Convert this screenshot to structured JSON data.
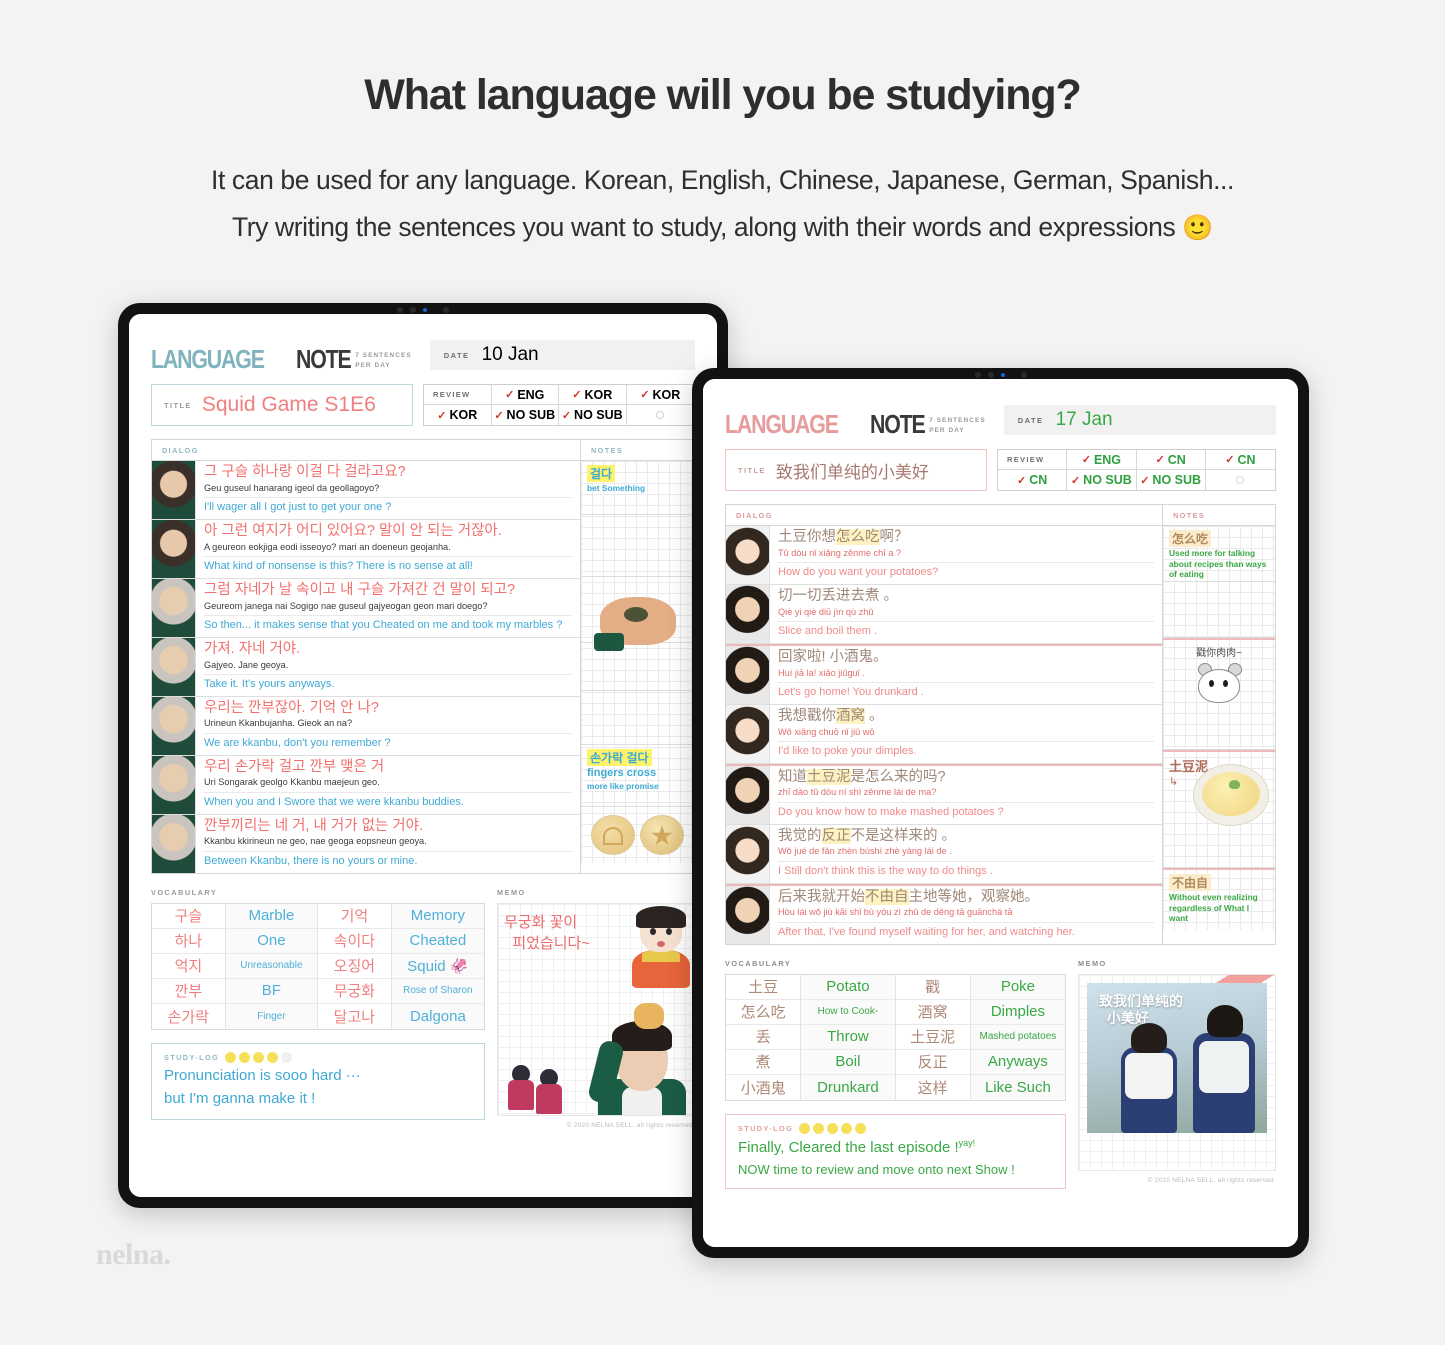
{
  "hero": {
    "title": "What language will you be studying?",
    "line1": "It can be used for any language. Korean, English, Chinese, Japanese, German, Spanish...",
    "line2": "Try writing the sentences you want to study, along with their words and expressions",
    "emoji": "🙂"
  },
  "watermark": "nelna.",
  "tablet_one": {
    "brand": {
      "word1": "LANGUAGE",
      "word2": "NOTE",
      "tag_line1": "7 SENTENCES",
      "tag_line2": "PER DAY"
    },
    "date": {
      "label": "DATE",
      "value": "10 Jan"
    },
    "title": {
      "label": "TITLE",
      "value": "Squid Game S1E6"
    },
    "review": {
      "header": "REVIEW",
      "cells": [
        "ENG",
        "KOR",
        "KOR",
        "KOR",
        "NO SUB",
        "NO SUB",
        ""
      ]
    },
    "dialog_header": "DIALOG",
    "notes_header": "NOTES",
    "dialog": [
      {
        "orig": "그 구슬 하나랑 이걸 다 걸라고요?",
        "roman": "Geu guseul hanarang  igeol da  geollagoyo?",
        "trans": "I'll wager all I got just to get your one ?"
      },
      {
        "orig": "아 그런 여지가 어디 있어요? 말이 안 되는 거잖아.",
        "roman": "A  geureon eokjiga  eodi  isseoyo? mari  an  doeneun geojanha.",
        "trans": "What kind of nonsense is this? There is no sense at all!"
      },
      {
        "orig": "그럼 자네가 날 속이고 내 구슬 가져간 건  말이 되고?",
        "roman": "Geureom janega nai  Sogigo nae guseul gajyeogan geon mari doego?",
        "trans": "So then... it makes sense that you Cheated on me and took my marbles ?"
      },
      {
        "orig": "가져. 자네 거야.",
        "roman": "Gajyeo.  Jane geoya.",
        "trans": "Take it. It's yours anyways."
      },
      {
        "orig": "우리는 깐부잖아. 기억 안 나?",
        "roman": "Urineun  Kkanbujanha. Gieok an na?",
        "trans": "We are  kkanbu, don't you remember ?"
      },
      {
        "orig": "우리 손가락 걸고 깐부 맺은 거",
        "roman": "Uri  Songarak geolgo Kkanbu maejeun geo.",
        "trans": "When you and I Swore that we were kkanbu buddies."
      },
      {
        "orig": "깐부끼리는 네 거, 내 거가 없는 거야.",
        "roman": "Kkanbu kkirineun  ne geo, nae geoga eopsneun geoya.",
        "trans": "Between Kkanbu, there is no yours or mine."
      }
    ],
    "notes": [
      {
        "keyword": "걸다",
        "text": "bet Something"
      },
      {
        "keyword": "",
        "text": ""
      },
      {
        "keyword": "",
        "text": "",
        "image": "hand-with-marbles"
      },
      {
        "keyword": "",
        "text": ""
      },
      {
        "keyword": "",
        "text": ""
      },
      {
        "keyword": "손가락 걸다",
        "text": "fingers cross",
        "subtext": "more like promise"
      },
      {
        "keyword": "",
        "text": "",
        "image": "dalgona-candies"
      }
    ],
    "vocabulary_label": "VOCABULARY",
    "vocabulary": [
      {
        "term": "구슬",
        "meaning": "Marble"
      },
      {
        "term": "기억",
        "meaning": "Memory"
      },
      {
        "term": "하나",
        "meaning": "One"
      },
      {
        "term": "속이다",
        "meaning": "Cheated"
      },
      {
        "term": "억지",
        "meaning": "Unreasonable",
        "small": true
      },
      {
        "term": "오징어",
        "meaning": "Squid 🦑"
      },
      {
        "term": "깐부",
        "meaning": "BF"
      },
      {
        "term": "무궁화",
        "meaning": "Rose of Sharon",
        "small": true
      },
      {
        "term": "손가락",
        "meaning": "Finger",
        "small": true
      },
      {
        "term": "달고나",
        "meaning": "Dalgona"
      }
    ],
    "study_log": {
      "label": "STUDY-LOG",
      "smileys_filled": 4,
      "smileys_total": 5,
      "line1": "Pronunciation is sooo hard ···",
      "line2": "but I'm ganna make it !"
    },
    "memo_label": "MEMO",
    "memo_text": "무궁화 꽃이\n피었습니다~",
    "copyright": "© 2020 NELNA SELL. all rights reserved."
  },
  "tablet_two": {
    "brand": {
      "word1": "LANGUAGE",
      "word2": "NOTE",
      "tag_line1": "7 SENTENCES",
      "tag_line2": "PER DAY"
    },
    "date": {
      "label": "DATE",
      "value": "17 Jan"
    },
    "title": {
      "label": "TITLE",
      "value": "致我们单纯的小美好"
    },
    "review": {
      "header": "REVIEW",
      "cells": [
        "ENG",
        "CN",
        "CN",
        "CN",
        "NO SUB",
        "NO SUB",
        ""
      ]
    },
    "dialog_header": "DIALOG",
    "notes_header": "NOTES",
    "dialog": [
      {
        "orig_pre": "土豆你想",
        "orig_hl": "怎么吃",
        "orig_post": "啊？",
        "roman": "Tǔ dòu nǐ xiǎng zěnme chī a ?",
        "trans": "How do you  want your potatoes?"
      },
      {
        "orig_pre": "切一切丢进去煮 。",
        "orig_hl": "",
        "orig_post": "",
        "roman": "Qiè yi  qiè diū jìn qù  zhǔ",
        "trans": "Slice and boil them ."
      },
      {
        "orig_pre": "回家啦!  小酒鬼。",
        "orig_hl": "",
        "orig_post": "",
        "roman": "Huí jiā  la!   xiǎo jiǔguǐ .",
        "trans": "Let's go home! You drunkard ."
      },
      {
        "orig_pre": "我想戳你",
        "orig_hl": "酒窝",
        "orig_post": " 。",
        "roman": "Wǒ xiǎng chuō nǐ  jiǔ wō",
        "trans": "I'd like to poke your dimples."
      },
      {
        "orig_pre": "知道",
        "orig_hl": "土豆泥",
        "orig_post": "是怎么来的吗?",
        "roman": "zhī dào tǔ dòu ní shì zěnme lái de ma?",
        "trans": "Do you know how to make mashed potatoes ?"
      },
      {
        "orig_pre": "我觉的",
        "orig_hl": "反正",
        "orig_post": "不是这样来的 。",
        "roman": "Wǒ jué de fǎn zhèn búshì zhè yàng lái de .",
        "trans": "I Still don't think this is the way to do things ."
      },
      {
        "orig_pre": "后来我就开始",
        "orig_hl": "不由自",
        "orig_post": "主地等她，观察她。",
        "roman": "Hòu lái wǒ jiù kāi shǐ bù yóu zì zhǔ de děng tā   guānchá tā",
        "trans": "After that, I've found myself waiting for her, and watching her."
      }
    ],
    "notes": [
      {
        "keyword": "怎么吃",
        "text": "Used more for talking about recipes than ways of eating"
      },
      {
        "keyword": "",
        "text": ""
      },
      {
        "keyword": "",
        "text": "",
        "image": "hamster-sticker",
        "caption": "戳你肉肉~"
      },
      {
        "keyword": "",
        "text": ""
      },
      {
        "keyword": "",
        "text": "",
        "image": "mashed-potato",
        "handwrite": "土豆泥"
      },
      {
        "keyword": "",
        "text": ""
      },
      {
        "keyword": "不由自",
        "text": "Without even realizing regardless of What I want"
      }
    ],
    "vocabulary_label": "VOCABULARY",
    "vocabulary": [
      {
        "term": "土豆",
        "meaning": "Potato"
      },
      {
        "term": "戳",
        "meaning": "Poke"
      },
      {
        "term": "怎么吃",
        "meaning": "How to Cook-",
        "small": true
      },
      {
        "term": "酒窝",
        "meaning": "Dimples"
      },
      {
        "term": "丢",
        "meaning": "Throw"
      },
      {
        "term": "土豆泥",
        "meaning": "Mashed potatoes",
        "small": true
      },
      {
        "term": "煮",
        "meaning": "Boil"
      },
      {
        "term": "反正",
        "meaning": "Anyways"
      },
      {
        "term": "小酒鬼",
        "meaning": "Drunkard"
      },
      {
        "term": "这样",
        "meaning": "Like Such"
      }
    ],
    "study_log": {
      "label": "STUDY-LOG",
      "smileys_filled": 5,
      "smileys_total": 5,
      "line1": "Finally, Cleared the last episode !",
      "line1_super": "yay!",
      "line2": "NOW time to review and move onto next Show !"
    },
    "memo_label": "MEMO",
    "memo_poster_title": "致我们单纯的\n小美好",
    "copyright": "© 2020 NELNA SELL. all rights reserved."
  }
}
